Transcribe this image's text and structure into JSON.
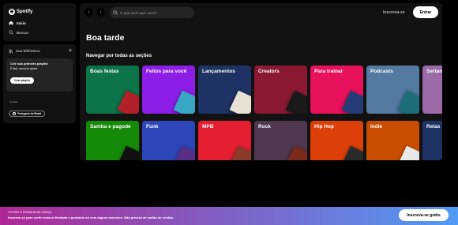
{
  "logo": {
    "text": "Spotify"
  },
  "nav": {
    "home": "Início",
    "search": "Buscar"
  },
  "library": {
    "title": "Sua biblioteca",
    "add_icon": "+",
    "card_title": "Crie sua primeira playlist",
    "card_sub": "É fácil, vamos te ajudar",
    "card_button": "Criar playlist",
    "cookies": "Cookies",
    "language": "Português do Brasil"
  },
  "topbar": {
    "back_icon": "‹",
    "forward_icon": "›",
    "search_placeholder": "O que você quer ouvir?",
    "signup": "Inscreva-se",
    "login": "Entrar"
  },
  "main": {
    "greeting": "Boa tarde",
    "section_title": "Navegar por todas as seções"
  },
  "tiles": [
    {
      "label": "Boas festas",
      "color": "#0d7349",
      "art": "#b3202a"
    },
    {
      "label": "Feitos para você",
      "color": "#8c1ee8",
      "art": "#39a7c4"
    },
    {
      "label": "Lançamentos",
      "color": "#1e3264",
      "art": "#e8e1d4"
    },
    {
      "label": "Creators",
      "color": "#8c1932",
      "art": "#1a1a1a"
    },
    {
      "label": "Para treinar",
      "color": "#e8115b",
      "art": "#273c76"
    },
    {
      "label": "Podcasts",
      "color": "#537aa1",
      "art": "#1d6e78"
    },
    {
      "label": "Sertanejo",
      "color": "#9c6aa8",
      "art": "#c18a52"
    },
    {
      "label": "Samba e pagode",
      "color": "#158a08",
      "art": "#111111"
    },
    {
      "label": "Funk",
      "color": "#2d46b9",
      "art": "#5a2e87"
    },
    {
      "label": "MPB",
      "color": "#e61e32",
      "art": "#8a3b2a"
    },
    {
      "label": "Rock",
      "color": "#4f374f",
      "art": "#7a2a1a"
    },
    {
      "label": "Hip Hop",
      "color": "#dc3f07",
      "art": "#2b2b2b"
    },
    {
      "label": "Indie",
      "color": "#c84d00",
      "art": "#e8e8e8"
    },
    {
      "label": "Relax",
      "color": "#1e3264",
      "art": "#6c8fa8"
    }
  ],
  "footer": {
    "title": "TESTAR O PREMIUM DE GRAÇA",
    "sub": "Inscreva-se para curtir música ilimitada e podcasts só com alguns anúncios. Não precisa de cartão de crédito.",
    "button": "Inscreva-se grátis"
  }
}
